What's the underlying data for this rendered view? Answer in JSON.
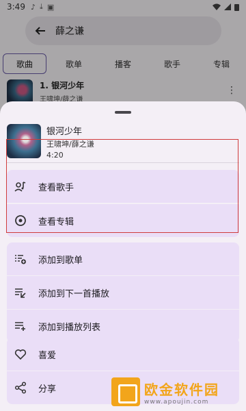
{
  "status_bar": {
    "time": "3:49"
  },
  "search": {
    "query": "薛之谦"
  },
  "tabs": [
    {
      "label": "歌曲"
    },
    {
      "label": "歌单"
    },
    {
      "label": "播客"
    },
    {
      "label": "歌手"
    },
    {
      "label": "专辑"
    }
  ],
  "background_row": {
    "title": "1. 银河少年",
    "subtitle": "王啸坤/薛之谦"
  },
  "sheet": {
    "song": {
      "name": "银河少年",
      "artist": "王啸坤/薛之谦",
      "duration": "4:20"
    },
    "actions": [
      {
        "label": "查看歌手",
        "icon": "artist-icon"
      },
      {
        "label": "查看专辑",
        "icon": "album-icon"
      },
      {
        "label": "添加到歌单",
        "icon": "playlist-add-icon"
      },
      {
        "label": "添加到下一首播放",
        "icon": "play-next-icon"
      },
      {
        "label": "添加到播放列表",
        "icon": "queue-add-icon"
      },
      {
        "label": "喜爱",
        "icon": "heart-icon"
      },
      {
        "label": "分享",
        "icon": "share-icon"
      }
    ]
  },
  "watermark": {
    "name": "欧金软件园",
    "url": "www.apoujin.com"
  },
  "colors": {
    "sheet_bg": "#f4eff6",
    "item_bg": "#eadef7",
    "highlight": "#d03b3b",
    "accent": "#6a5ba8"
  }
}
